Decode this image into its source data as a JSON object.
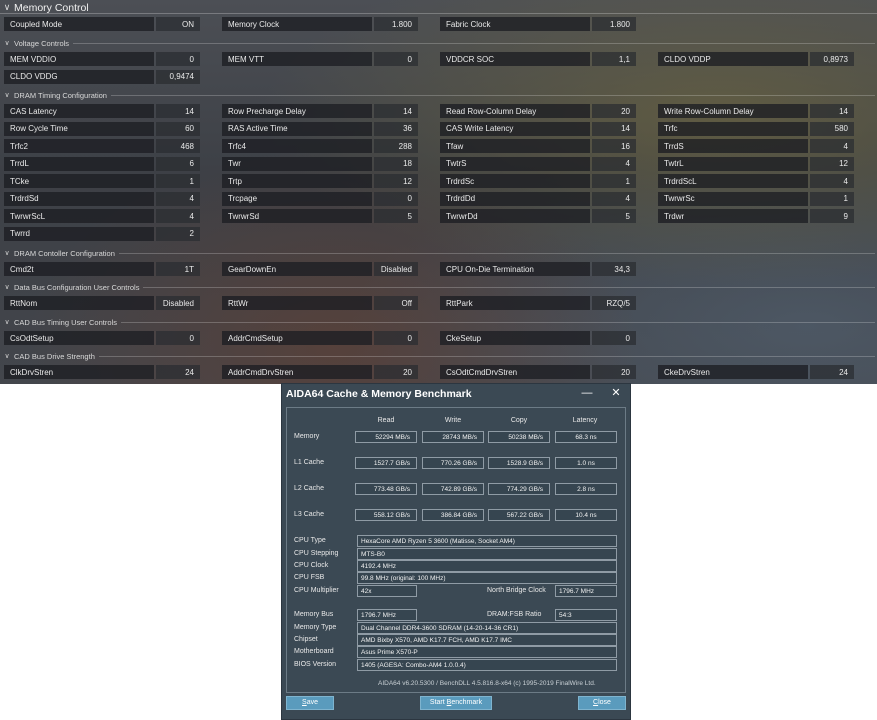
{
  "memory_control": {
    "title": "Memory Control",
    "top_rows": [
      [
        {
          "label": "Coupled Mode",
          "value": "ON"
        },
        {
          "label": "Memory Clock",
          "value": "1.800"
        },
        {
          "label": "Fabric Clock",
          "value": "1.800"
        }
      ]
    ],
    "sections": {
      "voltage": "Voltage Controls",
      "dram_timing": "DRAM Timing Configuration",
      "dram_controller": "DRAM Contoller Configuration",
      "data_bus": "Data Bus Configuration User Controls",
      "cad_timing": "CAD Bus Timing User Controls",
      "cad_drive": "CAD Bus Drive Strength"
    },
    "voltage_rows": [
      [
        {
          "label": "MEM VDDIO",
          "value": "0"
        },
        {
          "label": "MEM VTT",
          "value": "0"
        },
        {
          "label": "VDDCR SOC",
          "value": "1,1"
        },
        {
          "label": "CLDO VDDP",
          "value": "0,8973"
        }
      ],
      [
        {
          "label": "CLDO VDDG",
          "value": "0,9474"
        }
      ]
    ],
    "timing_rows": [
      [
        {
          "label": "CAS Latency",
          "value": "14"
        },
        {
          "label": "Row Precharge Delay",
          "value": "14"
        },
        {
          "label": "Read Row-Column Delay",
          "value": "20"
        },
        {
          "label": "Write Row-Column Delay",
          "value": "14"
        }
      ],
      [
        {
          "label": "Row Cycle Time",
          "value": "60"
        },
        {
          "label": "RAS Active Time",
          "value": "36"
        },
        {
          "label": "CAS Write Latency",
          "value": "14"
        },
        {
          "label": "Trfc",
          "value": "580"
        }
      ],
      [
        {
          "label": "Trfc2",
          "value": "468"
        },
        {
          "label": "Trfc4",
          "value": "288"
        },
        {
          "label": "Tfaw",
          "value": "16"
        },
        {
          "label": "TrrdS",
          "value": "4"
        }
      ],
      [
        {
          "label": "TrrdL",
          "value": "6"
        },
        {
          "label": "Twr",
          "value": "18"
        },
        {
          "label": "TwtrS",
          "value": "4"
        },
        {
          "label": "TwtrL",
          "value": "12"
        }
      ],
      [
        {
          "label": "TCke",
          "value": "1"
        },
        {
          "label": "Trtp",
          "value": "12"
        },
        {
          "label": "TrdrdSc",
          "value": "1"
        },
        {
          "label": "TrdrdScL",
          "value": "4"
        }
      ],
      [
        {
          "label": "TrdrdSd",
          "value": "4"
        },
        {
          "label": "Trcpage",
          "value": "0"
        },
        {
          "label": "TrdrdDd",
          "value": "4"
        },
        {
          "label": "TwrwrSc",
          "value": "1"
        }
      ],
      [
        {
          "label": "TwrwrScL",
          "value": "4"
        },
        {
          "label": "TwrwrSd",
          "value": "5"
        },
        {
          "label": "TwrwrDd",
          "value": "5"
        },
        {
          "label": "Trdwr",
          "value": "9"
        }
      ],
      [
        {
          "label": "Twrrd",
          "value": "2"
        }
      ]
    ],
    "controller_rows": [
      [
        {
          "label": "Cmd2t",
          "value": "1T"
        },
        {
          "label": "GearDownEn",
          "value": "Disabled"
        },
        {
          "label": "CPU On-Die Termination",
          "value": "34,3"
        }
      ]
    ],
    "data_bus_rows": [
      [
        {
          "label": "RttNom",
          "value": "Disabled"
        },
        {
          "label": "RttWr",
          "value": "Off"
        },
        {
          "label": "RttPark",
          "value": "RZQ/5"
        }
      ]
    ],
    "cad_timing_rows": [
      [
        {
          "label": "CsOdtSetup",
          "value": "0"
        },
        {
          "label": "AddrCmdSetup",
          "value": "0"
        },
        {
          "label": "CkeSetup",
          "value": "0"
        }
      ]
    ],
    "cad_drive_rows": [
      [
        {
          "label": "ClkDrvStren",
          "value": "24"
        },
        {
          "label": "AddrCmdDrvStren",
          "value": "20"
        },
        {
          "label": "CsOdtCmdDrvStren",
          "value": "20"
        },
        {
          "label": "CkeDrvStren",
          "value": "24"
        }
      ]
    ]
  },
  "aida": {
    "title": "AIDA64 Cache & Memory Benchmark",
    "minimize_glyph": "—",
    "close_glyph": "✕",
    "columns": [
      "Read",
      "Write",
      "Copy",
      "Latency"
    ],
    "bench_rows": [
      {
        "label": "Memory",
        "values": [
          "52294 MB/s",
          "28743 MB/s",
          "50238 MB/s",
          "68.3 ns"
        ]
      },
      {
        "label": "L1 Cache",
        "values": [
          "1527.7 GB/s",
          "770.26 GB/s",
          "1528.9 GB/s",
          "1.0 ns"
        ]
      },
      {
        "label": "L2 Cache",
        "values": [
          "773.48 GB/s",
          "742.89 GB/s",
          "774.29 GB/s",
          "2.8 ns"
        ]
      },
      {
        "label": "L3 Cache",
        "values": [
          "558.12 GB/s",
          "386.84 GB/s",
          "567.22 GB/s",
          "10.4 ns"
        ]
      }
    ],
    "cpu_info": {
      "cpu_type_label": "CPU Type",
      "cpu_type": "HexaCore AMD Ryzen 5 3600  (Matisse, Socket AM4)",
      "cpu_stepping_label": "CPU Stepping",
      "cpu_stepping": "MTS-B0",
      "cpu_clock_label": "CPU Clock",
      "cpu_clock": "4192.4 MHz",
      "cpu_fsb_label": "CPU FSB",
      "cpu_fsb": "99.8 MHz  (original: 100 MHz)",
      "cpu_multiplier_label": "CPU Multiplier",
      "cpu_multiplier": "42x",
      "nb_clock_label": "North Bridge Clock",
      "nb_clock": "1796.7 MHz"
    },
    "mem_info": {
      "memory_bus_label": "Memory Bus",
      "memory_bus": "1796.7 MHz",
      "dram_fsb_label": "DRAM:FSB Ratio",
      "dram_fsb": "54:3",
      "memory_type_label": "Memory Type",
      "memory_type": "Dual Channel DDR4-3600 SDRAM  (14-20-14-36 CR1)",
      "chipset_label": "Chipset",
      "chipset": "AMD Bixby X570, AMD K17.7 FCH, AMD K17.7 IMC",
      "motherboard_label": "Motherboard",
      "motherboard": "Asus Prime X570-P",
      "bios_label": "BIOS Version",
      "bios": "1405  (AGESA: Combo-AM4 1.0.0.4)"
    },
    "footer": "AIDA64 v6.20.5300 / BenchDLL 4.5.816.8-x64  (c) 1995-2019 FinalWire Ltd.",
    "buttons": {
      "save_ul": "S",
      "save_rest": "ave",
      "start_pre": "Start ",
      "start_ul": "B",
      "start_rest": "enchmark",
      "close_ul": "C",
      "close_rest": "lose"
    }
  }
}
